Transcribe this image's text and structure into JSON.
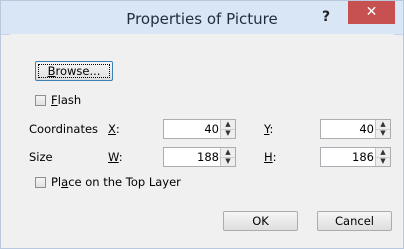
{
  "window": {
    "title": "Properties of Picture",
    "help": "?",
    "close": "✕"
  },
  "browse_button": {
    "prefix": "",
    "mnemonic": "B",
    "rest": "rowse..."
  },
  "flash": {
    "mnemonic": "F",
    "rest": "lash",
    "checked": false
  },
  "coordinates": {
    "label": "Coordinates",
    "x_label": "X",
    "x_label_suffix": ":",
    "x_value": "40",
    "y_label": "Y",
    "y_label_suffix": ":",
    "y_value": "40"
  },
  "size": {
    "label": "Size",
    "w_label": "W",
    "w_label_suffix": ":",
    "w_value": "188",
    "h_label": "H",
    "h_label_suffix": ":",
    "h_value": "186"
  },
  "top_layer": {
    "prefix": "Pl",
    "mnemonic": "a",
    "rest": "ce on the Top Layer",
    "checked": false
  },
  "buttons": {
    "ok": "OK",
    "cancel": "Cancel"
  },
  "icons": {
    "spin_up": "▲",
    "spin_down": "▼"
  }
}
